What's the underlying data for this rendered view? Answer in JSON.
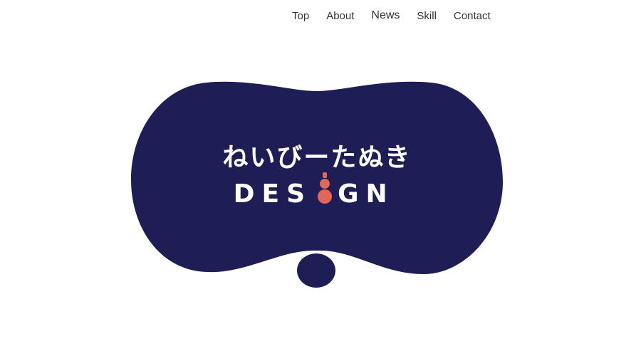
{
  "nav": {
    "items": [
      {
        "label": "Top"
      },
      {
        "label": "About"
      },
      {
        "label": "News"
      },
      {
        "label": "Skill"
      },
      {
        "label": "Contact"
      }
    ]
  },
  "logo": {
    "jp_text": "ねいびーたぬき",
    "en_text_left": "DES",
    "en_text_right": "GN",
    "bg_color": "#1f1d55",
    "accent_color": "#e0675a",
    "icon": "gourd-icon"
  }
}
